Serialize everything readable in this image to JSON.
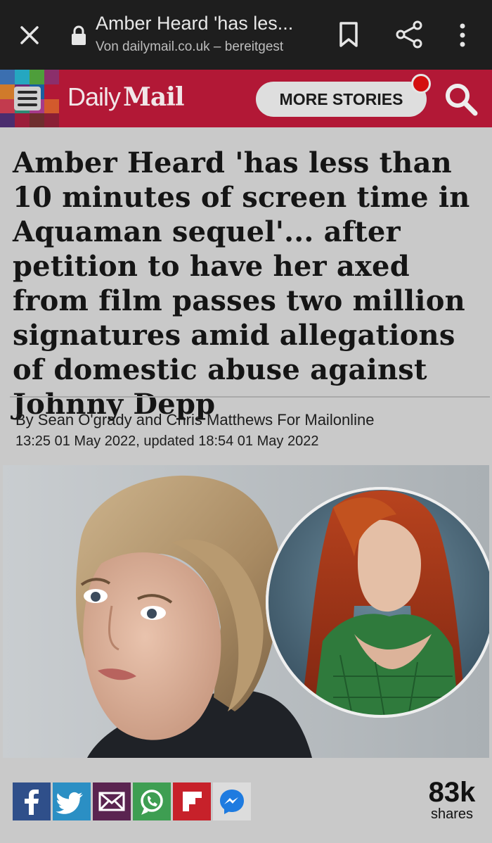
{
  "browser": {
    "tab_title": "Amber Heard 'has les...",
    "origin": "Von dailymail.co.uk – bereitgest",
    "icons": [
      "close-icon",
      "lock-icon",
      "bookmark-icon",
      "share-icon",
      "more-vert-icon"
    ]
  },
  "site": {
    "logo_daily": "Daily",
    "logo_mail": "Mail",
    "more_stories": "MORE STORIES",
    "accent_color": "#b21836"
  },
  "article": {
    "headline": "Amber Heard 'has less than 10 minutes of screen time in Aquaman sequel'... after petition to have her axed from film passes two million signatures amid allegations of domestic abuse against Johnny Depp",
    "byline": "By Sean O'grady and Chris Matthews For Mailonline",
    "dateline": "13:25 01 May 2022, updated 18:54 01 May 2022"
  },
  "share": {
    "buttons": [
      "facebook-icon",
      "twitter-icon",
      "email-icon",
      "whatsapp-icon",
      "flipboard-icon",
      "messenger-icon"
    ],
    "count": "83k",
    "label": "shares"
  }
}
